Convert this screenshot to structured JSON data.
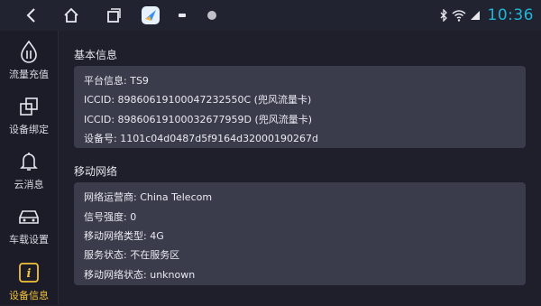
{
  "statusbar": {
    "time": "10:36",
    "nav_icons": [
      "back-icon",
      "home-icon",
      "recents-icon",
      "app-icon"
    ],
    "status_icons": [
      "bluetooth-icon",
      "wifi-icon",
      "signal-icon"
    ]
  },
  "sidebar": {
    "items": [
      {
        "label": "流量充值",
        "icon": "data-recharge-icon"
      },
      {
        "label": "设备绑定",
        "icon": "device-bind-icon"
      },
      {
        "label": "云消息",
        "icon": "bell-icon"
      },
      {
        "label": "车载设置",
        "icon": "car-icon"
      },
      {
        "label": "设备信息",
        "icon": "info-icon",
        "active": true
      }
    ]
  },
  "sections": [
    {
      "title": "基本信息",
      "rows": [
        {
          "label": "平台信息:",
          "value": "TS9"
        },
        {
          "label": "ICCID:",
          "value": "89860619100047232550C (兜风流量卡)"
        },
        {
          "label": "ICCID:",
          "value": "89860619100032677959D (兜风流量卡)"
        },
        {
          "label": "设备号:",
          "value": "1101c04d0487d5f9164d32000190267d"
        }
      ]
    },
    {
      "title": "移动网络",
      "rows": [
        {
          "label": "网络运营商:",
          "value": "China Telecom"
        },
        {
          "label": "信号强度:",
          "value": "0"
        },
        {
          "label": "移动网络类型:",
          "value": "4G"
        },
        {
          "label": "服务状态:",
          "value": "不在服务区"
        },
        {
          "label": "移动网络状态:",
          "value": "unknown"
        }
      ]
    }
  ],
  "colors": {
    "accent_clock": "#1fb6d8",
    "active_tab": "#f2c23a",
    "card_bg": "#3a3b4b",
    "page_bg": "#1e1f2b"
  }
}
